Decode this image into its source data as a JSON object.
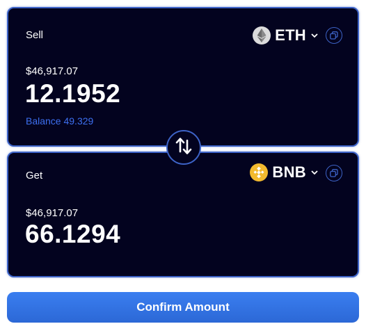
{
  "sell": {
    "label": "Sell",
    "token": {
      "symbol": "ETH",
      "icon": "ethereum-icon"
    },
    "usd_value": "$46,917.07",
    "amount": "12.1952",
    "balance": "Balance 49.329"
  },
  "get": {
    "label": "Get",
    "token": {
      "symbol": "BNB",
      "icon": "bnb-icon"
    },
    "usd_value": "$46,917.07",
    "amount": "66.1294"
  },
  "swap_icon": "swap-arrows-icon",
  "confirm_label": "Confirm Amount",
  "colors": {
    "card_bg": "#03031f",
    "border": "#3d63c7",
    "balance_text": "#3d6ff0",
    "button": "#3a7ef0",
    "bnb": "#f3ba2f"
  }
}
